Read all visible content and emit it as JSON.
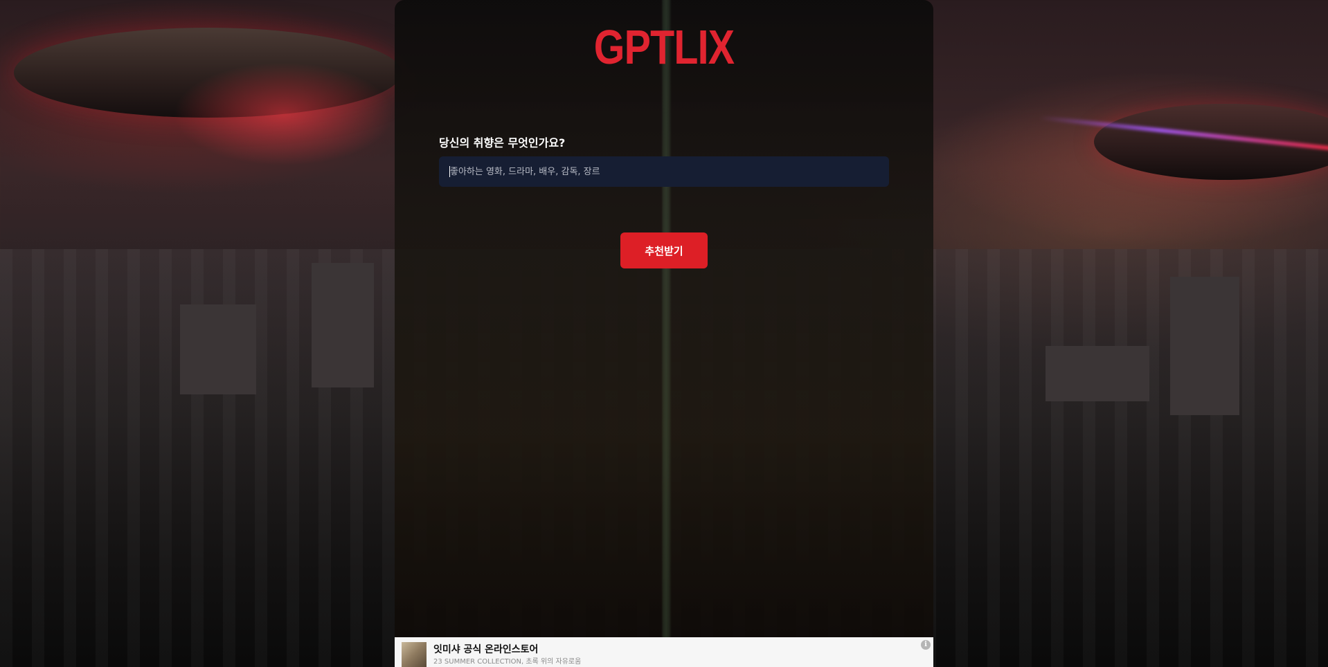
{
  "app": {
    "logo_text": "GPTLIX",
    "brand_color": "#dd1f26"
  },
  "form": {
    "question": "당신의 취향은 무엇인가요?",
    "input_value": "",
    "input_placeholder": "좋아하는 영화, 드라마, 배우, 감독, 장르",
    "submit_label": "추천받기"
  },
  "ad": {
    "title": "잇미샤 공식 온라인스토어",
    "subtitle": "23 SUMMER COLLECTION, 초록 위의 자유로움",
    "info_icon": "info-icon"
  }
}
